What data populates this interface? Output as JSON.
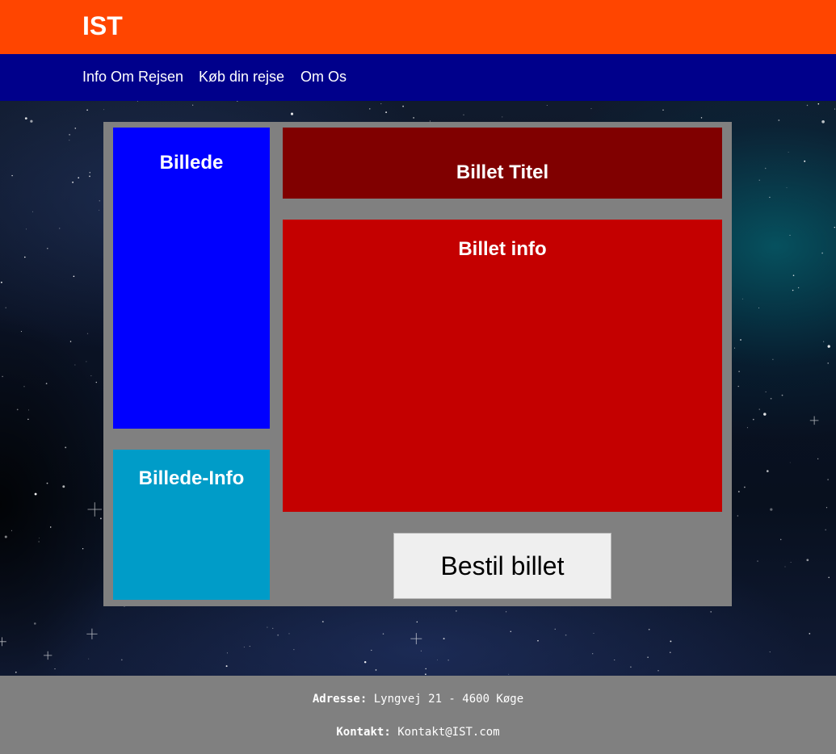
{
  "header": {
    "brand": "IST",
    "background_color": "#ff4500"
  },
  "nav": {
    "background_color": "#00008b",
    "links": [
      {
        "label": "Info Om Rejsen"
      },
      {
        "label": "Køb din rejse"
      },
      {
        "label": "Om Os"
      }
    ]
  },
  "main": {
    "card_color": "#808080",
    "billede": {
      "label": "Billede",
      "color": "#0000ff"
    },
    "billede_info": {
      "label": "Billede-Info",
      "color": "#009cc8"
    },
    "billet_titel": {
      "label": "Billet Titel",
      "color": "#800000"
    },
    "billet_info": {
      "label": "Billet info",
      "color": "#c40000"
    },
    "order_button": {
      "label": "Bestil billet"
    }
  },
  "footer": {
    "address_label": "Adresse:",
    "address_value": "Lyngvej 21 - 4600 Køge",
    "contact_label": "Kontakt:",
    "contact_value": "Kontakt@IST.com"
  }
}
